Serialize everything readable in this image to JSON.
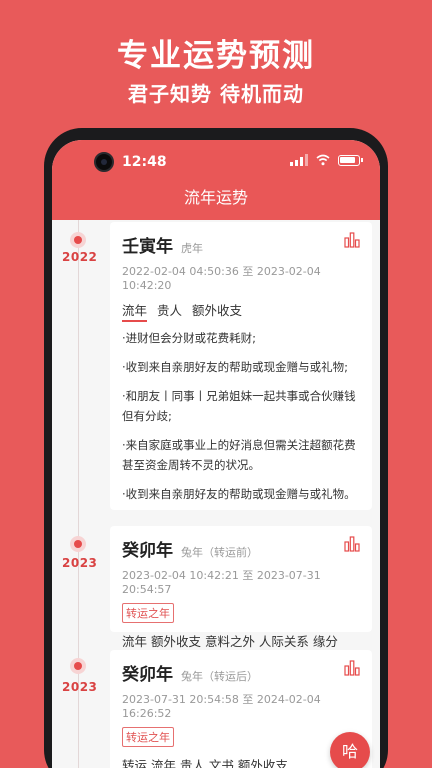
{
  "promo": {
    "title": "专业运势预测",
    "subtitle": "君子知势 待机而动"
  },
  "status_bar": {
    "time": "12:48",
    "icons": [
      "signal-icon",
      "wifi-icon",
      "battery-icon"
    ]
  },
  "app_bar": {
    "title": "流年运势"
  },
  "accent_color": "#e95757",
  "entries": [
    {
      "year": "2022",
      "title": "壬寅年",
      "zodiac": "虎年",
      "date_range": "2022-02-04 04:50:36 至 2023-02-04 10:42:20",
      "tags": [
        "流年",
        "贵人",
        "额外收支"
      ],
      "active_tag": "流年",
      "paragraphs": [
        "·进财但会分财或花费耗财;",
        "·收到来自亲朋好友的帮助或现金赠与或礼物;",
        "·和朋友丨同事丨兄弟姐妹一起共事或合伙赚钱但有分歧;",
        "·来自家庭或事业上的好消息但需关注超额花费甚至资金周转不灵的状况。",
        "·收到来自亲朋好友的帮助或现金赠与或礼物。"
      ]
    },
    {
      "year": "2023",
      "title": "癸卯年",
      "zodiac": "兔年（转运前）",
      "date_range": "2023-02-04 10:42:21 至 2023-07-31 20:54:57",
      "badge": "转运之年",
      "tags_line": "流年  额外收支  意料之外  人际关系  缘分"
    },
    {
      "year": "2023",
      "title": "癸卯年",
      "zodiac": "兔年（转运后）",
      "date_range": "2023-07-31 20:54:58 至 2024-02-04 16:26:52",
      "badge": "转运之年",
      "tags_line": "转运  流年  贵人  文书  额外收支"
    }
  ],
  "floating_button": {
    "label": "哈"
  }
}
